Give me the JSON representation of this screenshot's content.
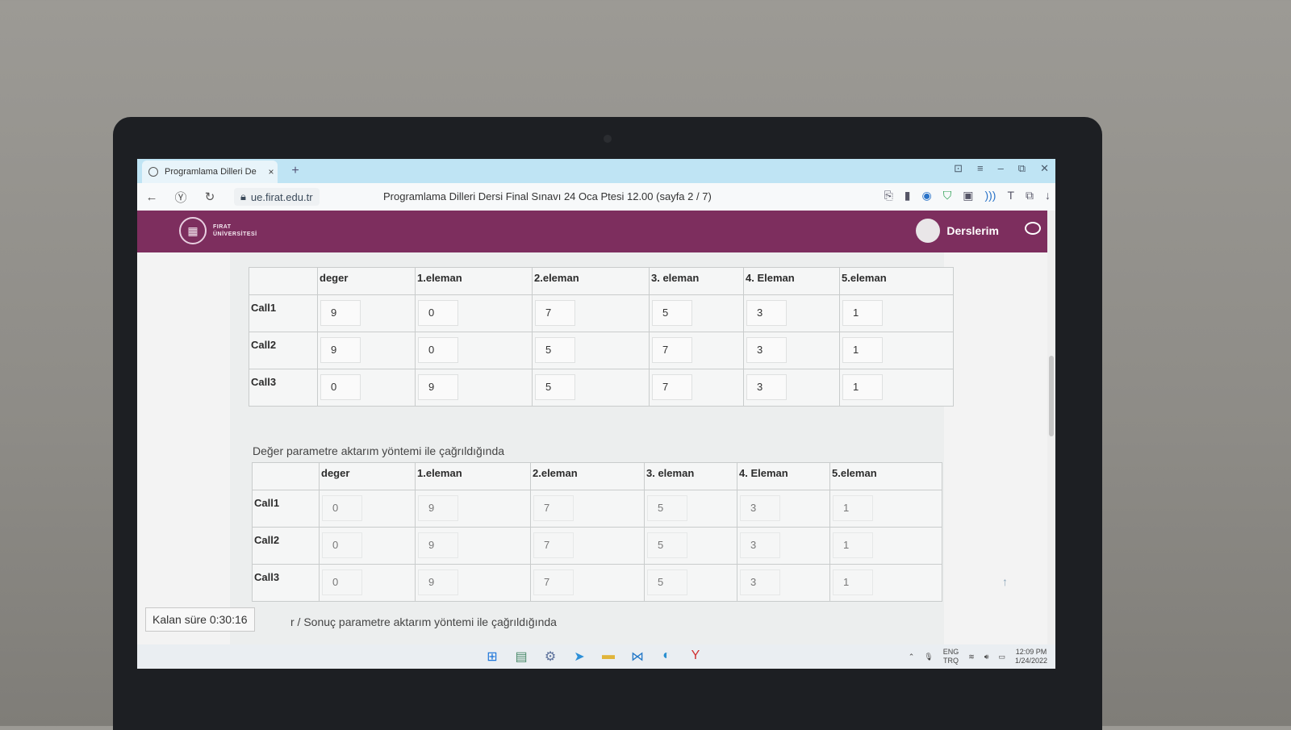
{
  "browser": {
    "tab_title": "Programlama Dilleri De",
    "tab_close": "×",
    "new_tab": "+",
    "url": "ue.firat.edu.tr",
    "page_title": "Programlama Dilleri Dersi Final Sınavı 24 Oca Ptesi 12.00 (sayfa 2 / 7)",
    "window_controls": [
      "⊡",
      "≡",
      "–",
      "⧉",
      "✕"
    ],
    "nav_icons": [
      "back-arrow-icon",
      "yandex-icon",
      "reload-icon",
      "lock-icon"
    ],
    "tool_icons": [
      "translate-icon",
      "bookmark-icon",
      "alice-icon",
      "protect-shield-icon",
      "gallery-icon",
      "audio-icon",
      "text-icon",
      "extensions-icon",
      "download-icon"
    ]
  },
  "site": {
    "logo_line1": "FIRAT",
    "logo_line2": "ÜNİVERSİTESİ",
    "user_label": "Derslerim"
  },
  "table1": {
    "headers": [
      "",
      "deger",
      "1.eleman",
      "2.eleman",
      "3. eleman",
      "4. Eleman",
      "5.eleman"
    ],
    "rows": [
      {
        "label": "Call1",
        "values": [
          "9",
          "0",
          "7",
          "5",
          "3",
          "1"
        ]
      },
      {
        "label": "Call2",
        "values": [
          "9",
          "0",
          "5",
          "7",
          "3",
          "1"
        ]
      },
      {
        "label": "Call3",
        "values": [
          "0",
          "9",
          "5",
          "7",
          "3",
          "1"
        ]
      }
    ]
  },
  "caption2": "Değer parametre aktarım yöntemi ile çağrıldığında",
  "table2": {
    "headers": [
      "",
      "deger",
      "1.eleman",
      "2.eleman",
      "3. eleman",
      "4. Eleman",
      "5.eleman"
    ],
    "rows": [
      {
        "label": "Call1",
        "values": [
          "0",
          "9",
          "7",
          "5",
          "3",
          "1"
        ]
      },
      {
        "label": "Call2",
        "values": [
          "0",
          "9",
          "7",
          "5",
          "3",
          "1"
        ]
      },
      {
        "label": "Call3",
        "values": [
          "0",
          "9",
          "7",
          "5",
          "3",
          "1"
        ]
      }
    ]
  },
  "timer": "Kalan süre 0:30:16",
  "next_caption": "r / Sonuç parametre aktarım yöntemi ile çağrıldığında",
  "taskbar": {
    "tray_lang_1": "ENG",
    "tray_lang_2": "TRQ",
    "time": "12:09 PM",
    "date": "1/24/2022"
  }
}
